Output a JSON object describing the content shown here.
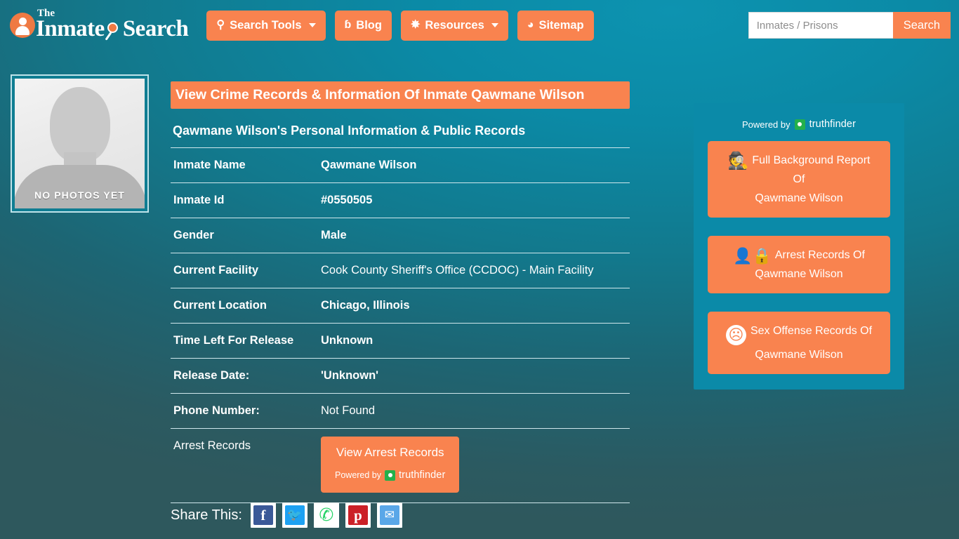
{
  "header": {
    "logo": {
      "the": "The",
      "name": "Inmate",
      "suffix": "Search"
    },
    "nav": [
      {
        "label": "Search Tools",
        "icon": "magnifier-icon",
        "glyph": "⌕",
        "caret": true
      },
      {
        "label": "Blog",
        "icon": "blogger-icon",
        "glyph": "ƀ",
        "caret": false
      },
      {
        "label": "Resources",
        "icon": "leaf-icon",
        "glyph": "⚘",
        "caret": true
      },
      {
        "label": "Sitemap",
        "icon": "rss-icon",
        "glyph": "ᴦ",
        "caret": false
      }
    ],
    "search": {
      "placeholder": "Inmates / Prisons",
      "value": "",
      "button": "Search"
    }
  },
  "photo": {
    "caption": "NO PHOTOS YET",
    "alt": "inmate-photo-placeholder"
  },
  "main": {
    "page_title": "View Crime Records & Information Of Inmate Qawmane Wilson",
    "sub_title": "Qawmane Wilson's Personal Information & Public Records",
    "rows": [
      {
        "key": "Inmate Name",
        "value": "Qawmane Wilson",
        "bold": true
      },
      {
        "key": "Inmate Id",
        "value": "#0550505",
        "bold": true
      },
      {
        "key": "Gender",
        "value": "Male",
        "bold": true
      },
      {
        "key": "Current Facility",
        "value": "Cook County Sheriff's Office (CCDOC) - Main Facility",
        "bold": false
      },
      {
        "key": "Current Location",
        "value": "Chicago, Illinois",
        "bold": true
      },
      {
        "key": "Time Left For Release",
        "value": "Unknown",
        "bold": true
      },
      {
        "key": "Release Date:",
        "value": "'Unknown'",
        "bold": true
      },
      {
        "key": "Phone Number:",
        "value": "Not Found",
        "bold": false
      }
    ],
    "arrest_row": {
      "key": "Arrest Records",
      "button_label": "View Arrest Records",
      "powered_by": "Powered by",
      "brand": "truthfinder"
    }
  },
  "share": {
    "label": "Share This:",
    "buttons": [
      {
        "name": "facebook",
        "glyph": "f"
      },
      {
        "name": "twitter",
        "glyph": "ᴦ"
      },
      {
        "name": "whatsapp",
        "glyph": "✆"
      },
      {
        "name": "pinterest",
        "glyph": "ᴘ"
      },
      {
        "name": "email",
        "glyph": "✉"
      }
    ]
  },
  "sidebar": {
    "powered_by": "Powered by",
    "brand": "truthfinder",
    "buttons": [
      {
        "icon": "spy-icon",
        "glyph": "🕵",
        "line1": "Full Background Report",
        "line2": "Of",
        "line3": "Qawmane Wilson"
      },
      {
        "icon": "person-lock-icon",
        "glyph": "👤🔒",
        "line1": "Arrest Records Of",
        "line2": "Qawmane Wilson",
        "line3": ""
      },
      {
        "icon": "angry-face-icon",
        "glyph": "☹",
        "line1": "Sex Offense Records Of",
        "line2": "Qawmane Wilson",
        "line3": ""
      }
    ]
  },
  "colors": {
    "accent_orange": "#f9834f",
    "teal_bg": "#12798d",
    "teal_panel": "#0b8aa8",
    "text_white": "#ffffff"
  }
}
